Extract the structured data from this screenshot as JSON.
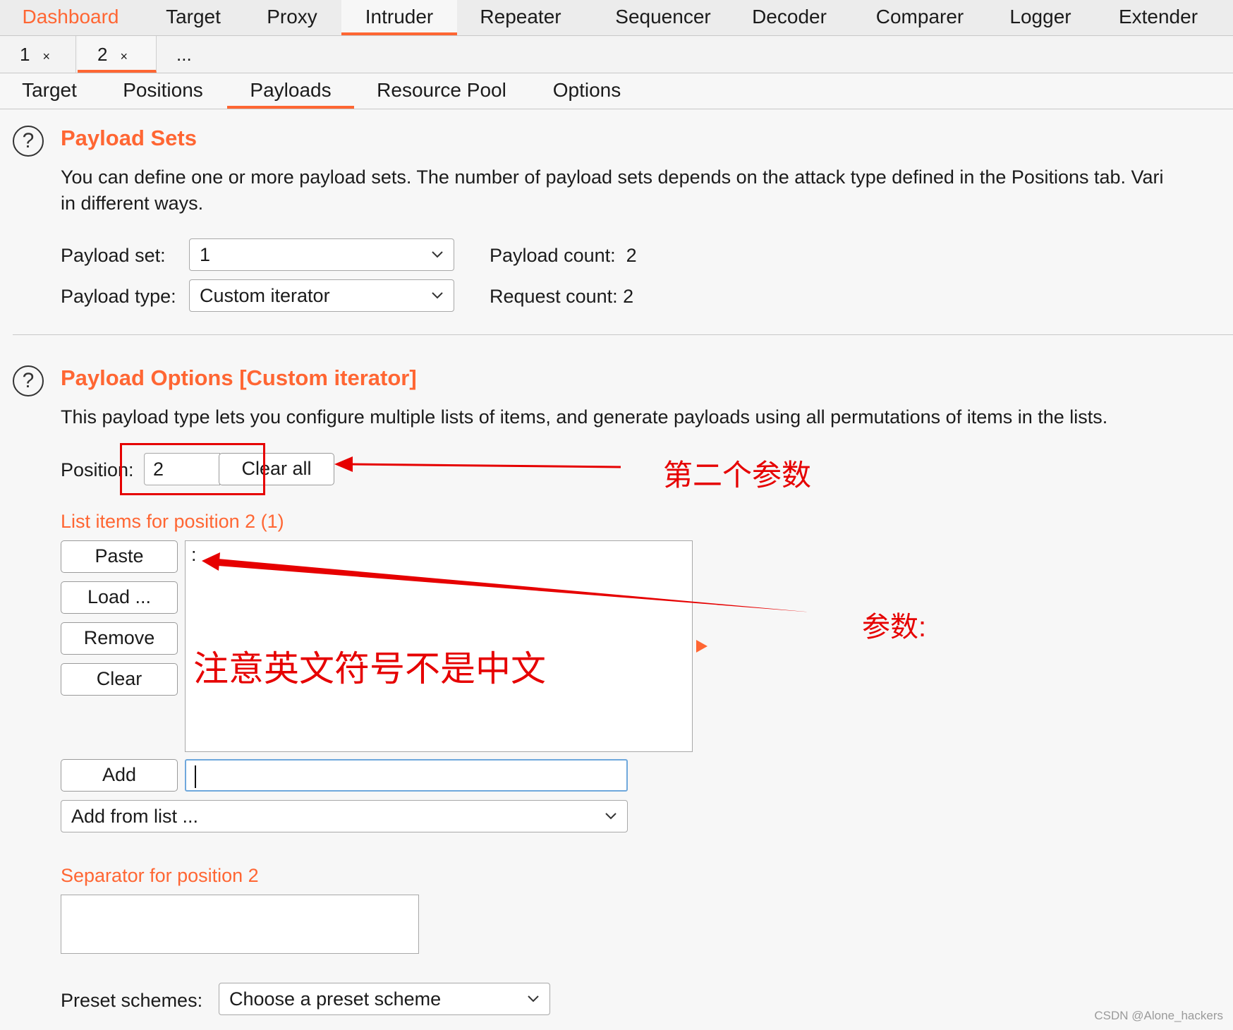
{
  "top_tabs": [
    "Dashboard",
    "Target",
    "Proxy",
    "Intruder",
    "Repeater",
    "Sequencer",
    "Decoder",
    "Comparer",
    "Logger",
    "Extender"
  ],
  "instance_tabs": [
    {
      "label": "1",
      "close": "×"
    },
    {
      "label": "2",
      "close": "×"
    },
    {
      "label": "..."
    }
  ],
  "sub_tabs": [
    "Target",
    "Positions",
    "Payloads",
    "Resource Pool",
    "Options"
  ],
  "payload_sets": {
    "heading": "Payload Sets",
    "desc_line1": "You can define one or more payload sets. The number of payload sets depends on the attack type defined in the Positions tab. Vari",
    "desc_line2": "in different ways.",
    "set_label": "Payload set:",
    "set_value": "1",
    "type_label": "Payload type:",
    "type_value": "Custom iterator",
    "count_label": "Payload count:",
    "count_value": "2",
    "request_label": "Request count:",
    "request_value": "2"
  },
  "payload_options": {
    "heading": "Payload Options [Custom iterator]",
    "desc": "This payload type lets you configure multiple lists of items, and generate payloads using all permutations of items in the lists.",
    "position_label": "Position:",
    "position_value": "2",
    "clear_all": "Clear all",
    "list_label": "List items for position 2 (1)",
    "buttons": {
      "paste": "Paste",
      "load": "Load ...",
      "remove": "Remove",
      "clear": "Clear",
      "add": "Add"
    },
    "list_items": [
      ":"
    ],
    "add_input_value": "",
    "add_from_list": "Add from list ...",
    "separator_label": "Separator for position 2",
    "separator_value": "",
    "preset_label": "Preset schemes:",
    "preset_value": "Choose a preset scheme"
  },
  "annotations": {
    "second_param": "第二个参数",
    "param": "参数:",
    "note": "注意英文符号不是中文",
    "color": "#e60000"
  },
  "watermark": "CSDN @Alone_hackers",
  "colors": {
    "accent": "#ff6633",
    "background": "#f7f7f7"
  }
}
